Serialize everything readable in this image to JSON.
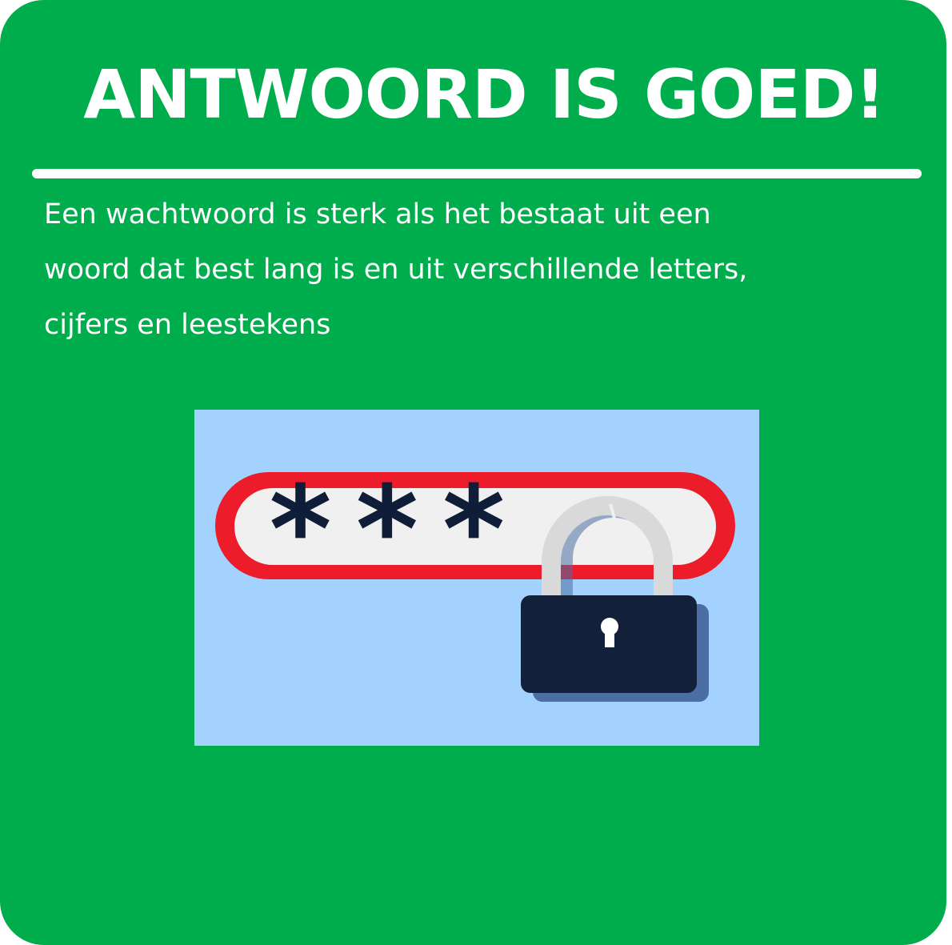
{
  "colors": {
    "card_background": "#00ad4d",
    "text": "#ffffff",
    "illustration_background": "#a2d2fd",
    "field_border": "#ec1c2b",
    "field_fill": "#f0f0f0",
    "mask_characters": "#0f1d38",
    "lock_body": "#122139",
    "lock_shadow": "#4b6ea4",
    "shackle": "#d9d9d9"
  },
  "header": {
    "title": "ANTWOORD IS GOED!"
  },
  "explanation": {
    "lines": [
      "Een wachtwoord is sterk als het bestaat uit een",
      "woord dat best lang is en uit verschillende letters,",
      "cijfers en leestekens"
    ]
  },
  "illustration": {
    "password_field_mask": "***",
    "icons": [
      "password-field-icon",
      "padlock-icon",
      "keyhole-icon"
    ]
  }
}
